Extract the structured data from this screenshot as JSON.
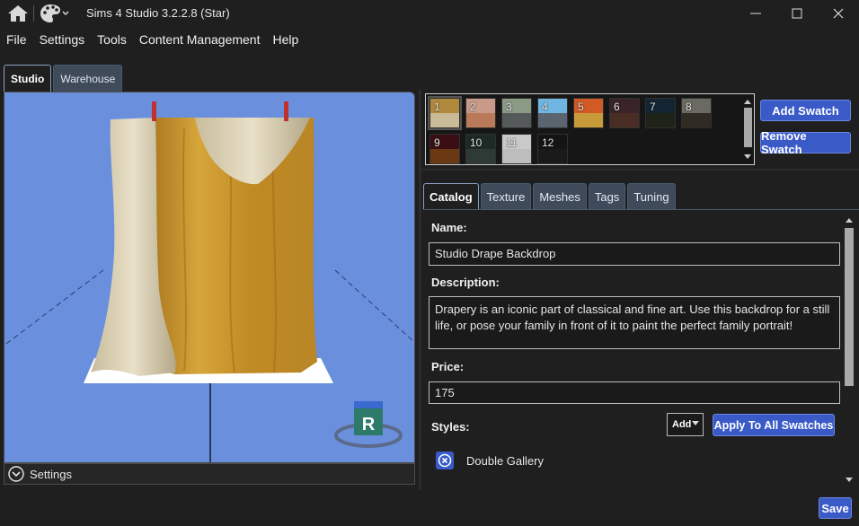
{
  "window": {
    "title": "Sims 4 Studio 3.2.2.8 (Star)"
  },
  "menu": [
    "File",
    "Settings",
    "Tools",
    "Content Management",
    "Help"
  ],
  "left_tabs": [
    {
      "label": "Studio",
      "active": true
    },
    {
      "label": "Warehouse",
      "active": false
    }
  ],
  "viewport": {
    "settings_label": "Settings",
    "badge_letter": "R"
  },
  "swatches": [
    {
      "num": "1",
      "top": "#b08a3c",
      "bottom": "#c9bb97",
      "selected": true
    },
    {
      "num": "2",
      "top": "#c99a8a",
      "bottom": "#b87a58"
    },
    {
      "num": "3",
      "top": "#8a9a85",
      "bottom": "#56595a"
    },
    {
      "num": "4",
      "top": "#6fb6e2",
      "bottom": "#5a6570"
    },
    {
      "num": "5",
      "top": "#d25a24",
      "bottom": "#c79a3a"
    },
    {
      "num": "6",
      "top": "#3a2428",
      "bottom": "#4a2e25"
    },
    {
      "num": "7",
      "top": "#132432",
      "bottom": "#1e2218"
    },
    {
      "num": "8",
      "top": "#6b6a62",
      "bottom": "#2f2b22"
    },
    {
      "num": "9",
      "top": "#3a0e12",
      "bottom": "#6a3812"
    },
    {
      "num": "10",
      "top": "#1e2a26",
      "bottom": "#2e3a36"
    },
    {
      "num": "11",
      "top": "#c9c9c9",
      "bottom": "#bdbdbd"
    },
    {
      "num": "12",
      "top": "#141414",
      "bottom": "#1a1a1a"
    }
  ],
  "buttons": {
    "add_swatch": "Add Swatch",
    "remove_swatch": "Remove Swatch",
    "apply_all": "Apply To All Swatches",
    "save": "Save"
  },
  "right_tabs": [
    {
      "label": "Catalog",
      "active": true
    },
    {
      "label": "Texture"
    },
    {
      "label": "Meshes"
    },
    {
      "label": "Tags"
    },
    {
      "label": "Tuning"
    }
  ],
  "catalog": {
    "name_label": "Name:",
    "name_value": "Studio Drape Backdrop",
    "description_label": "Description:",
    "description_value": "Drapery is an iconic part of classical and fine art. Use this backdrop for a still life, or pose your family in front of it to paint the perfect family portrait!",
    "price_label": "Price:",
    "price_value": "175",
    "styles_label": "Styles:",
    "styles_mode": "Add",
    "style_items": [
      "Double Gallery"
    ]
  },
  "colors": {
    "accent": "#3a5ac8",
    "viewport_bg": "#6a8fdd",
    "drape": "#c8962c"
  }
}
